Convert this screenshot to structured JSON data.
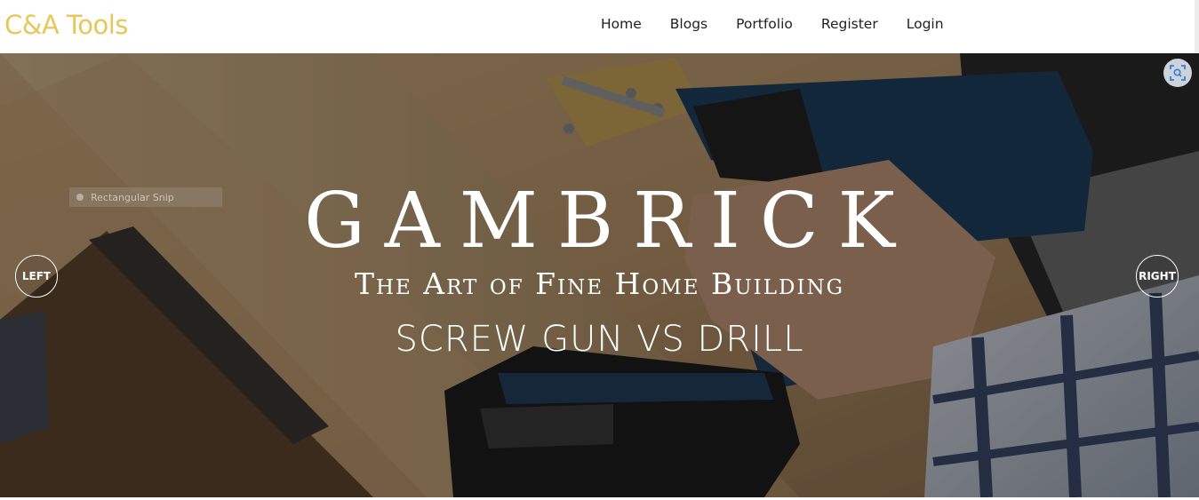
{
  "brand": {
    "name": "C&A Tools",
    "color": "#e8c75a"
  },
  "nav": {
    "items": [
      {
        "label": "Home"
      },
      {
        "label": "Blogs"
      },
      {
        "label": "Portfolio"
      },
      {
        "label": "Register"
      },
      {
        "label": "Login"
      }
    ]
  },
  "hero": {
    "title": "GAMBRICK",
    "subtitle": "The Art of Fine Home Building",
    "tagline": "SCREW GUN VS DRILL",
    "left_button": "LEFT",
    "right_button": "RIGHT",
    "snip_label": "Rectangular Snip",
    "lens_icon": "visual-search-icon",
    "image_subject": "drill-on-lumber-photo"
  }
}
